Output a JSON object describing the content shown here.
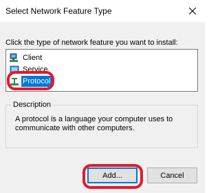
{
  "window": {
    "title": "Select Network Feature Type"
  },
  "instruction": "Click the type of network feature you want to install:",
  "features": [
    {
      "label": "Client",
      "icon": "client-icon",
      "selected": false
    },
    {
      "label": "Service",
      "icon": "service-icon",
      "selected": false
    },
    {
      "label": "Protocol",
      "icon": "protocol-icon",
      "selected": true
    }
  ],
  "description": {
    "group_label": "Description",
    "text": "A protocol is a language your computer uses to communicate with other computers."
  },
  "buttons": {
    "add": "Add...",
    "cancel": "Cancel"
  },
  "colors": {
    "selection": "#0078d7",
    "annotation": "#e21a2c"
  }
}
